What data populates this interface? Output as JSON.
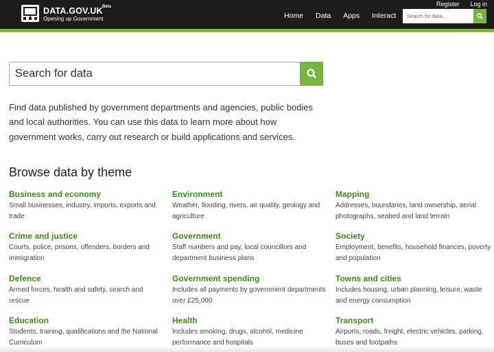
{
  "header": {
    "brand": "DATA.GOV.UK",
    "beta": "Beta",
    "tagline": "Opening up Government",
    "top_links": [
      "Register",
      "Log in"
    ],
    "nav": [
      "Home",
      "Data",
      "Apps",
      "Interact"
    ],
    "active_nav": "Home",
    "search_placeholder": "Search for data...",
    "accent_color": "#78b543"
  },
  "main": {
    "search_placeholder": "Search for data",
    "intro": "Find data published by government departments and agencies, public bodies and local authorities. You can use this data to learn more about how government works, carry out research or build applications and services.",
    "browse_title": "Browse data by theme",
    "themes": [
      {
        "title": "Business and economy",
        "desc": "Small businesses, industry, imports, exports and trade"
      },
      {
        "title": "Environment",
        "desc": "Weather, flooding, rivers, air quality, geology and agriculture"
      },
      {
        "title": "Mapping",
        "desc": "Addresses, boundaries, land ownership, aerial photographs, seabed and land terrain"
      },
      {
        "title": "Crime and justice",
        "desc": "Courts, police, prisons, offenders, borders and immigration"
      },
      {
        "title": "Government",
        "desc": "Staff numbers and pay, local councillors and department business plans"
      },
      {
        "title": "Society",
        "desc": "Employment, benefits, household finances, poverty and population"
      },
      {
        "title": "Defence",
        "desc": "Armed forces, health and safety, search and rescue"
      },
      {
        "title": "Government spending",
        "desc": "Includes all payments by government departments over £25,000"
      },
      {
        "title": "Towns and cities",
        "desc": "Includes housing, urban planning, leisure, waste and energy consumption"
      },
      {
        "title": "Education",
        "desc": "Students, training, qualifications and the National Curriculum"
      },
      {
        "title": "Health",
        "desc": "Includes smoking, drugs, alcohol, medicine performance and hospitals"
      },
      {
        "title": "Transport",
        "desc": "Airports, roads, freight, electric vehicles, parking, buses and footpaths"
      }
    ]
  }
}
